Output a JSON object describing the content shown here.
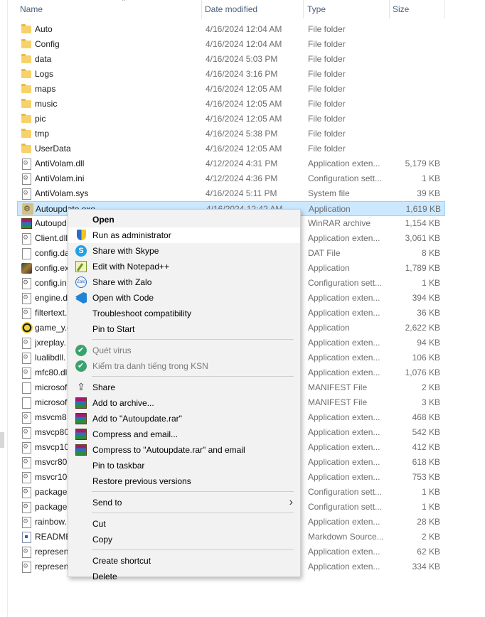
{
  "header": {
    "columns": [
      "Name",
      "Date modified",
      "Type",
      "Size"
    ],
    "sort_indicator": "^"
  },
  "files": [
    {
      "name": "Auto",
      "date": "4/16/2024 12:04 AM",
      "type": "File folder",
      "size": "",
      "icon": "folder-icon"
    },
    {
      "name": "Config",
      "date": "4/16/2024 12:04 AM",
      "type": "File folder",
      "size": "",
      "icon": "folder-icon"
    },
    {
      "name": "data",
      "date": "4/16/2024 5:03 PM",
      "type": "File folder",
      "size": "",
      "icon": "folder-icon"
    },
    {
      "name": "Logs",
      "date": "4/16/2024 3:16 PM",
      "type": "File folder",
      "size": "",
      "icon": "folder-icon"
    },
    {
      "name": "maps",
      "date": "4/16/2024 12:05 AM",
      "type": "File folder",
      "size": "",
      "icon": "folder-icon"
    },
    {
      "name": "music",
      "date": "4/16/2024 12:05 AM",
      "type": "File folder",
      "size": "",
      "icon": "folder-icon"
    },
    {
      "name": "pic",
      "date": "4/16/2024 12:05 AM",
      "type": "File folder",
      "size": "",
      "icon": "folder-icon"
    },
    {
      "name": "tmp",
      "date": "4/16/2024 5:38 PM",
      "type": "File folder",
      "size": "",
      "icon": "folder-icon"
    },
    {
      "name": "UserData",
      "date": "4/16/2024 12:05 AM",
      "type": "File folder",
      "size": "",
      "icon": "folder-icon"
    },
    {
      "name": "AntiVolam.dll",
      "date": "4/12/2024 4:31 PM",
      "type": "Application exten...",
      "size": "5,179 KB",
      "icon": "dll-file-icon"
    },
    {
      "name": "AntiVolam.ini",
      "date": "4/12/2024 4:36 PM",
      "type": "Configuration sett...",
      "size": "1 KB",
      "icon": "config-file-icon"
    },
    {
      "name": "AntiVolam.sys",
      "date": "4/16/2024 5:11 PM",
      "type": "System file",
      "size": "39 KB",
      "icon": "system-file-icon"
    },
    {
      "name": "Autoupdate.exe",
      "date": "4/16/2024 12:42 AM",
      "type": "Application",
      "size": "1,619 KB",
      "icon": "application-icon",
      "selected": true
    },
    {
      "name": "Autoupd",
      "date": "",
      "type": "WinRAR archive",
      "size": "1,154 KB",
      "icon": "winrar-archive-icon"
    },
    {
      "name": "Client.dll",
      "date": "",
      "type": "Application exten...",
      "size": "3,061 KB",
      "icon": "dll-file-icon"
    },
    {
      "name": "config.da",
      "date": "",
      "type": "DAT File",
      "size": "8 KB",
      "icon": "file-icon"
    },
    {
      "name": "config.ex",
      "date": "",
      "type": "Application",
      "size": "1,789 KB",
      "icon": "game-application-icon"
    },
    {
      "name": "config.in",
      "date": "",
      "type": "Configuration sett...",
      "size": "1 KB",
      "icon": "config-file-icon"
    },
    {
      "name": "engine.d",
      "date": "",
      "type": "Application exten...",
      "size": "394 KB",
      "icon": "dll-file-icon"
    },
    {
      "name": "filtertext.",
      "date": "",
      "type": "Application exten...",
      "size": "36 KB",
      "icon": "dll-file-icon"
    },
    {
      "name": "game_y.e",
      "date": "",
      "type": "Application",
      "size": "2,622 KB",
      "icon": "game-y-icon"
    },
    {
      "name": "jxreplay.",
      "date": "",
      "type": "Application exten...",
      "size": "94 KB",
      "icon": "dll-file-icon"
    },
    {
      "name": "lualibdll.",
      "date": "",
      "type": "Application exten...",
      "size": "106 KB",
      "icon": "dll-file-icon"
    },
    {
      "name": "mfc80.dll",
      "date": "",
      "type": "Application exten...",
      "size": "1,076 KB",
      "icon": "dll-file-icon"
    },
    {
      "name": "microsof",
      "date": "",
      "type": "MANIFEST File",
      "size": "2 KB",
      "icon": "file-icon"
    },
    {
      "name": "microsof",
      "date": "",
      "type": "MANIFEST File",
      "size": "3 KB",
      "icon": "file-icon"
    },
    {
      "name": "msvcm8",
      "date": "",
      "type": "Application exten...",
      "size": "468 KB",
      "icon": "dll-file-icon"
    },
    {
      "name": "msvcp80",
      "date": "",
      "type": "Application exten...",
      "size": "542 KB",
      "icon": "dll-file-icon"
    },
    {
      "name": "msvcp10",
      "date": "",
      "type": "Application exten...",
      "size": "412 KB",
      "icon": "dll-file-icon"
    },
    {
      "name": "msvcr80.",
      "date": "",
      "type": "Application exten...",
      "size": "618 KB",
      "icon": "dll-file-icon"
    },
    {
      "name": "msvcr100",
      "date": "",
      "type": "Application exten...",
      "size": "753 KB",
      "icon": "dll-file-icon"
    },
    {
      "name": "package.",
      "date": "",
      "type": "Configuration sett...",
      "size": "1 KB",
      "icon": "config-file-icon"
    },
    {
      "name": "package1",
      "date": "",
      "type": "Configuration sett...",
      "size": "1 KB",
      "icon": "config-file-icon"
    },
    {
      "name": "rainbow.",
      "date": "",
      "type": "Application exten...",
      "size": "28 KB",
      "icon": "dll-file-icon"
    },
    {
      "name": "README",
      "date": "",
      "type": "Markdown Source...",
      "size": "2 KB",
      "icon": "markdown-file-icon"
    },
    {
      "name": "represen",
      "date": "",
      "type": "Application exten...",
      "size": "62 KB",
      "icon": "dll-file-icon"
    },
    {
      "name": "represen",
      "date": "",
      "type": "Application exten...",
      "size": "334 KB",
      "icon": "dll-file-icon"
    }
  ],
  "context_menu": {
    "items": [
      {
        "label": "Open",
        "bold": true,
        "icon": ""
      },
      {
        "label": "Run as administrator",
        "icon": "uac-shield-icon",
        "highlight": true
      },
      {
        "label": "Share with Skype",
        "icon": "skype-icon"
      },
      {
        "label": "Edit with Notepad++",
        "icon": "notepad-plus-plus-icon"
      },
      {
        "label": "Share with Zalo",
        "icon": "zalo-icon"
      },
      {
        "label": "Open with Code",
        "icon": "vscode-icon"
      },
      {
        "label": "Troubleshoot compatibility",
        "icon": ""
      },
      {
        "label": "Pin to Start",
        "icon": ""
      },
      {
        "separator": true
      },
      {
        "label": "Quét virus",
        "icon": "kaspersky-shield-icon",
        "disabled": true
      },
      {
        "label": "Kiểm tra danh tiếng trong KSN",
        "icon": "kaspersky-shield-icon",
        "disabled": true
      },
      {
        "separator": true
      },
      {
        "label": "Share",
        "icon": "share-icon"
      },
      {
        "label": "Add to archive...",
        "icon": "winrar-icon"
      },
      {
        "label": "Add to \"Autoupdate.rar\"",
        "icon": "winrar-icon"
      },
      {
        "label": "Compress and email...",
        "icon": "winrar-icon"
      },
      {
        "label": "Compress to \"Autoupdate.rar\" and email",
        "icon": "winrar-icon"
      },
      {
        "label": "Pin to taskbar",
        "icon": ""
      },
      {
        "label": "Restore previous versions",
        "icon": ""
      },
      {
        "separator": true
      },
      {
        "label": "Send to",
        "icon": "",
        "submenu": true
      },
      {
        "separator": true
      },
      {
        "label": "Cut",
        "icon": ""
      },
      {
        "label": "Copy",
        "icon": ""
      },
      {
        "separator": true
      },
      {
        "label": "Create shortcut",
        "icon": ""
      },
      {
        "label": "Delete",
        "icon": ""
      }
    ],
    "submenu_arrow": "›"
  },
  "colors": {
    "selection_bg": "#cce8ff",
    "selection_border": "#99d1ff",
    "menu_bg": "#f2f2f2",
    "header_text": "#4c607a"
  }
}
